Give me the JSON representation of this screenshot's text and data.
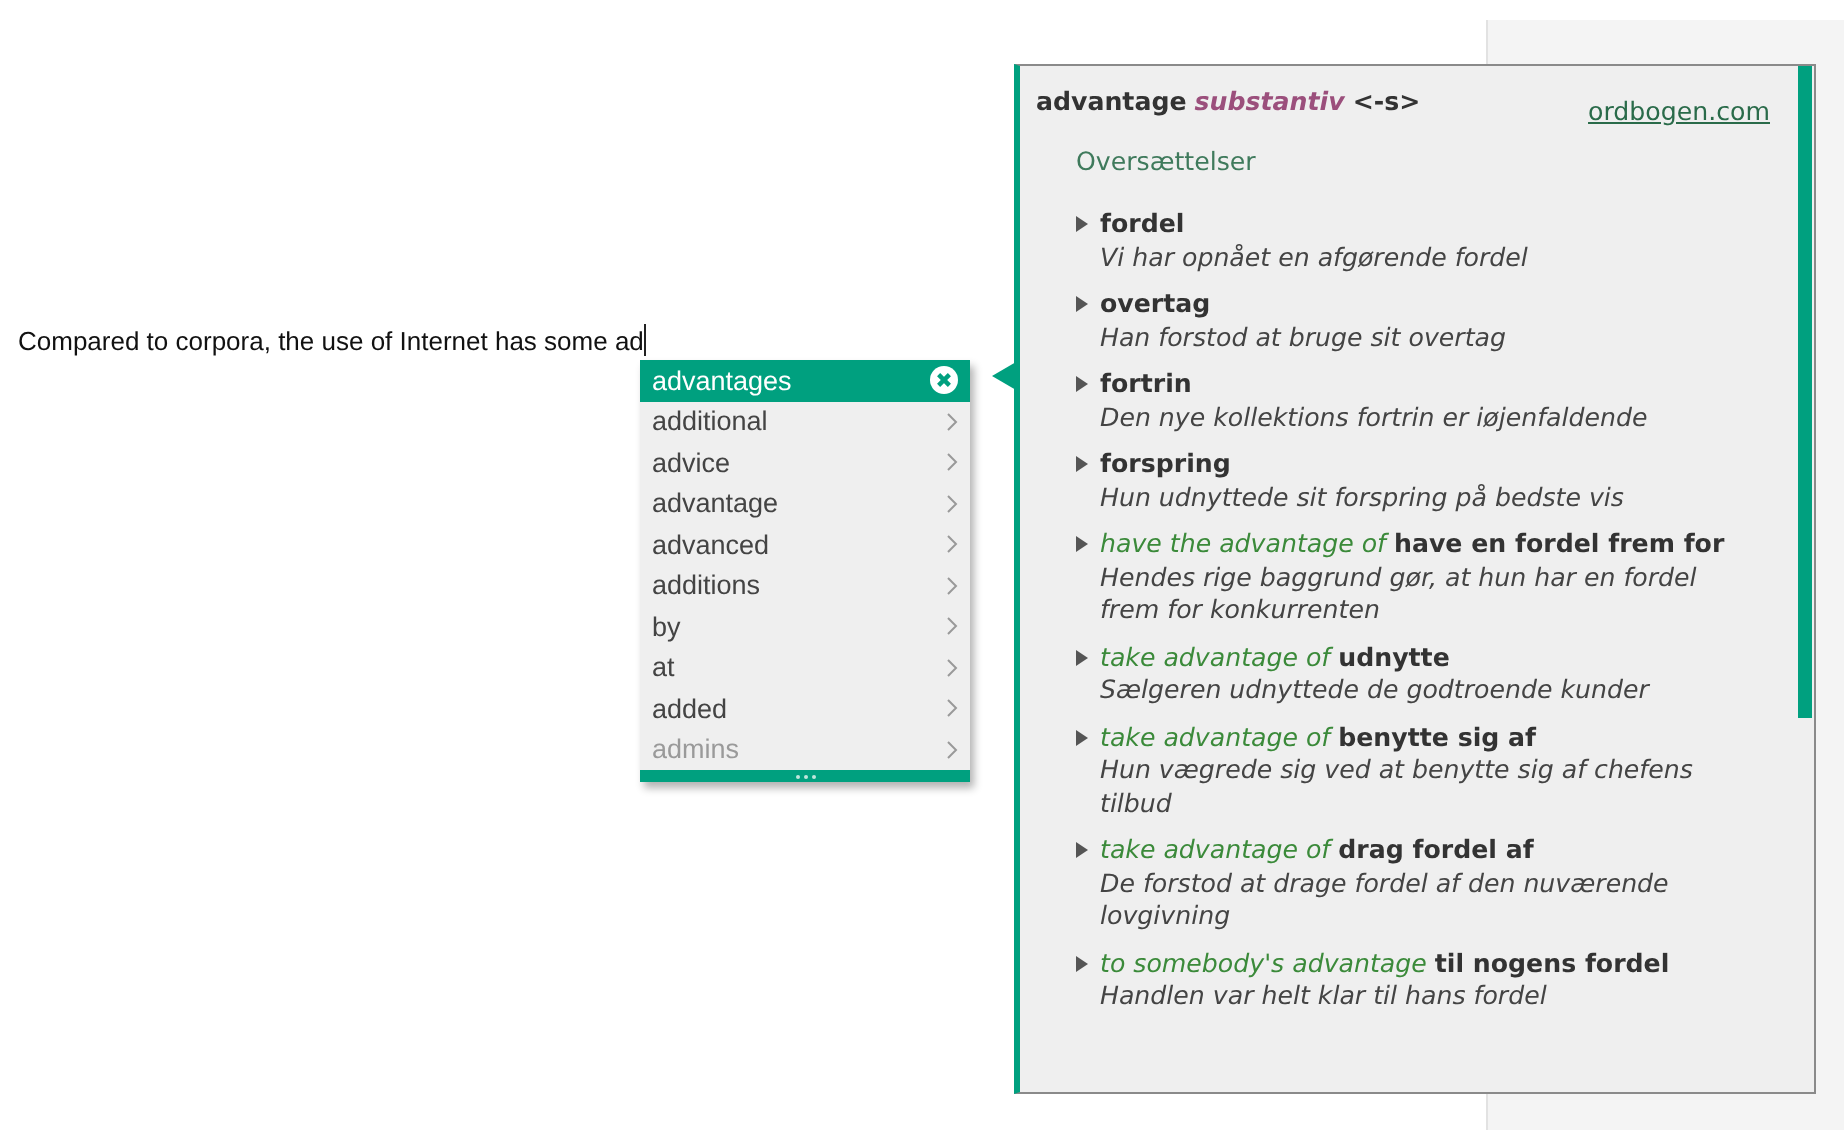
{
  "document": {
    "text": "Compared to corpora, the use of Internet has some ad"
  },
  "suggestions": {
    "items": [
      {
        "label": "advantages",
        "selected": true,
        "faded": false
      },
      {
        "label": "additional",
        "selected": false,
        "faded": false
      },
      {
        "label": "advice",
        "selected": false,
        "faded": false
      },
      {
        "label": "advantage",
        "selected": false,
        "faded": false
      },
      {
        "label": "advanced",
        "selected": false,
        "faded": false
      },
      {
        "label": "additions",
        "selected": false,
        "faded": false
      },
      {
        "label": "by",
        "selected": false,
        "faded": false
      },
      {
        "label": "at",
        "selected": false,
        "faded": false
      },
      {
        "label": "added",
        "selected": false,
        "faded": false
      },
      {
        "label": "admins",
        "selected": false,
        "faded": true
      }
    ]
  },
  "dictionary": {
    "headword": "advantage",
    "word_class": "substantiv",
    "inflection": "<-s>",
    "source_link": "ordbogen.com",
    "section": "Oversættelser",
    "entries": [
      {
        "translation": "fordel",
        "example": "Vi har opnået en afgørende fordel"
      },
      {
        "translation": "overtag",
        "example": "Han forstod at bruge sit overtag"
      },
      {
        "translation": "fortrin",
        "example": "Den nye kollektions fortrin er iøjenfaldende"
      },
      {
        "translation": "forspring",
        "example": "Hun udnyttede sit forspring på bedste vis"
      },
      {
        "phrase": "have the advantage of",
        "translation": "have en fordel frem for",
        "example": "Hendes rige baggrund gør, at hun har en fordel frem for konkurrenten"
      },
      {
        "phrase": "take advantage of",
        "translation": "udnytte",
        "example": "Sælgeren udnyttede de godtroende kunder"
      },
      {
        "phrase": "take advantage of",
        "translation": "benytte sig af",
        "example": "Hun vægrede sig ved at benytte sig af chefens tilbud"
      },
      {
        "phrase": "take advantage of",
        "translation": "drag fordel af",
        "example": "De forstod at drage fordel af den nuværende lovgivning"
      },
      {
        "phrase": "to somebody's advantage",
        "translation": "til nogens fordel",
        "example": "Handlen var helt klar til hans fordel"
      }
    ]
  }
}
